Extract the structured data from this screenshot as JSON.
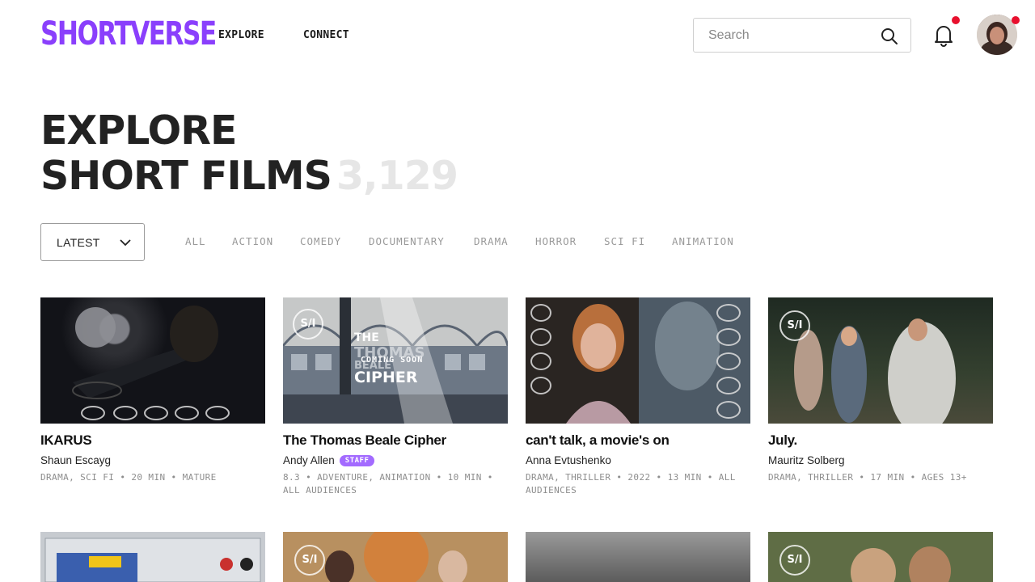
{
  "brand": {
    "logo": "SHORTVERSE",
    "accent": "#8a3ffc"
  },
  "nav": {
    "explore": "EXPLORE",
    "connect": "CONNECT"
  },
  "search": {
    "placeholder": "Search"
  },
  "heading": {
    "line1": "EXPLORE",
    "line2": "SHORT FILMS",
    "count": "3,129"
  },
  "sort": {
    "selected": "LATEST"
  },
  "genres": [
    "ALL",
    "ACTION",
    "COMEDY",
    "DOCUMENTARY",
    "DRAMA",
    "HORROR",
    "SCI FI",
    "ANIMATION"
  ],
  "films": [
    {
      "title": "IKARUS",
      "author": "Shaun Escayg",
      "meta": "DRAMA, SCI FI • 20 MIN • MATURE"
    },
    {
      "title": "The Thomas Beale Cipher",
      "author": "Andy Allen",
      "badge": "STAFF",
      "meta": "8.3 • ADVENTURE, ANIMATION • 10 MIN • ALL AUDIENCES",
      "thumb_text": {
        "line1": "THE",
        "line2": "THOMAS",
        "line3": "BEALE",
        "line4": "CIPHER",
        "coming": "COMING SOON"
      }
    },
    {
      "title": "can't talk, a movie's on",
      "author": "Anna Evtushenko",
      "meta": "DRAMA, THRILLER • 2022 • 13 MIN • ALL AUDIENCES"
    },
    {
      "title": "July.",
      "author": "Mauritz Solberg",
      "meta": "DRAMA, THRILLER • 17 MIN • AGES 13+"
    }
  ],
  "thumb_logo": "S/I"
}
